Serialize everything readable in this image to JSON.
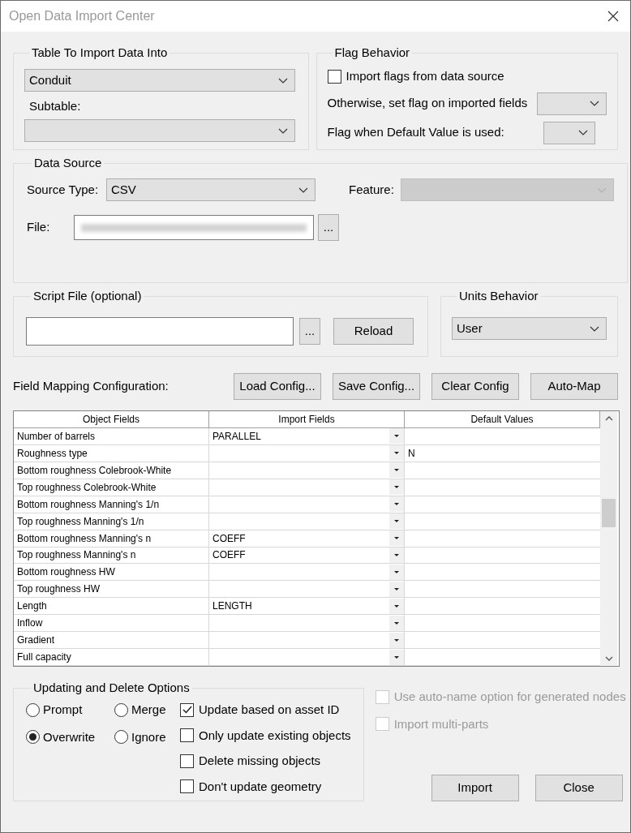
{
  "window": {
    "title": "Open Data Import Center"
  },
  "table_group": {
    "title": "Table To Import Data Into",
    "table": "Conduit",
    "subtable_label": "Subtable:"
  },
  "flag_behavior": {
    "title": "Flag Behavior",
    "import_flags": {
      "label": "Import flags from data source",
      "checked": false
    },
    "otherwise_label": "Otherwise, set flag on imported fields",
    "default_label": "Flag when Default Value is used:"
  },
  "data_source": {
    "title": "Data Source",
    "source_type_label": "Source Type:",
    "source_type": "CSV",
    "feature_label": "Feature:",
    "feature_disabled": true,
    "file_label": "File:",
    "browse": "..."
  },
  "script_file": {
    "title": "Script File (optional)",
    "browse": "...",
    "reload": "Reload"
  },
  "units_behavior": {
    "title": "Units Behavior",
    "value": "User"
  },
  "field_mapping": {
    "label": "Field Mapping Configuration:",
    "buttons": [
      "Load Config...",
      "Save Config...",
      "Clear Config",
      "Auto-Map"
    ]
  },
  "grid": {
    "columns": [
      "Object Fields",
      "Import Fields",
      "Default Values"
    ],
    "rows": [
      {
        "object": "Number of barrels",
        "import": "PARALLEL"
      },
      {
        "object": "Roughness type",
        "default": "N"
      },
      {
        "object": "Bottom roughness Colebrook-White"
      },
      {
        "object": "Top roughness Colebrook-White"
      },
      {
        "object": "Bottom roughness Manning's 1/n"
      },
      {
        "object": "Top roughness Manning's 1/n"
      },
      {
        "object": "Bottom roughness Manning's n",
        "import": "COEFF"
      },
      {
        "object": "Top roughness Manning's n",
        "import": "COEFF"
      },
      {
        "object": "Bottom roughness HW"
      },
      {
        "object": "Top roughness HW"
      },
      {
        "object": "Length",
        "import": "LENGTH"
      },
      {
        "object": "Inflow"
      },
      {
        "object": "Gradient"
      },
      {
        "object": "Full capacity"
      }
    ]
  },
  "updating": {
    "title": "Updating and Delete Options",
    "radios": [
      {
        "label": "Prompt",
        "selected": false
      },
      {
        "label": "Merge",
        "selected": false
      },
      {
        "label": "Overwrite",
        "selected": true
      },
      {
        "label": "Ignore",
        "selected": false
      }
    ],
    "checkboxes": [
      {
        "label": "Update based on asset ID",
        "checked": true
      },
      {
        "label": "Only update existing objects",
        "checked": false
      },
      {
        "label": "Delete missing objects",
        "checked": false
      },
      {
        "label": "Don't update geometry",
        "checked": false
      }
    ]
  },
  "extra_options": [
    {
      "label": "Use auto-name option for generated nodes",
      "checked": false,
      "disabled": true
    },
    {
      "label": "Import multi-parts",
      "checked": false,
      "disabled": true
    }
  ],
  "buttons": [
    "Import",
    "Close"
  ]
}
